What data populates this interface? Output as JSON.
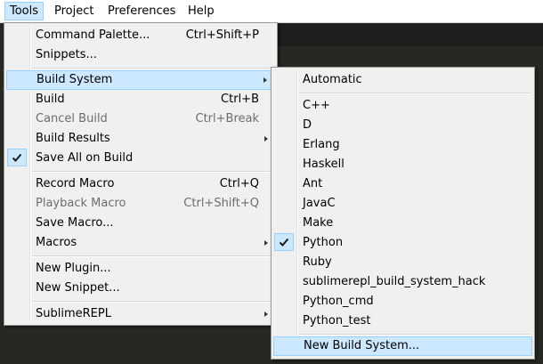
{
  "menubar": {
    "tools": "Tools",
    "project": "Project",
    "preferences": "Preferences",
    "help": "Help"
  },
  "tools_menu": {
    "command_palette": {
      "label": "Command Palette...",
      "shortcut": "Ctrl+Shift+P"
    },
    "snippets": {
      "label": "Snippets..."
    },
    "build_system": {
      "label": "Build System"
    },
    "build": {
      "label": "Build",
      "shortcut": "Ctrl+B"
    },
    "cancel_build": {
      "label": "Cancel Build",
      "shortcut": "Ctrl+Break"
    },
    "build_results": {
      "label": "Build Results"
    },
    "save_all_on_build": {
      "label": "Save All on Build"
    },
    "record_macro": {
      "label": "Record Macro",
      "shortcut": "Ctrl+Q"
    },
    "playback_macro": {
      "label": "Playback Macro",
      "shortcut": "Ctrl+Shift+Q"
    },
    "save_macro": {
      "label": "Save Macro..."
    },
    "macros": {
      "label": "Macros"
    },
    "new_plugin": {
      "label": "New Plugin..."
    },
    "new_snippet": {
      "label": "New Snippet..."
    },
    "sublimerepl": {
      "label": "SublimeREPL"
    }
  },
  "build_system_menu": {
    "items": [
      "Automatic",
      "C++",
      "D",
      "Erlang",
      "Haskell",
      "Ant",
      "JavaC",
      "Make",
      "Python",
      "Ruby",
      "sublimerepl_build_system_hack",
      "Python_cmd",
      "Python_test",
      "New Build System..."
    ]
  },
  "colors": {
    "highlight": "#cce8ff",
    "highlight_border": "#99d1ff",
    "menu_bg": "#f0f0f0",
    "editor_bg": "#272822"
  },
  "icons": {
    "check": "check-icon",
    "submenu": "chevron-right-icon"
  }
}
